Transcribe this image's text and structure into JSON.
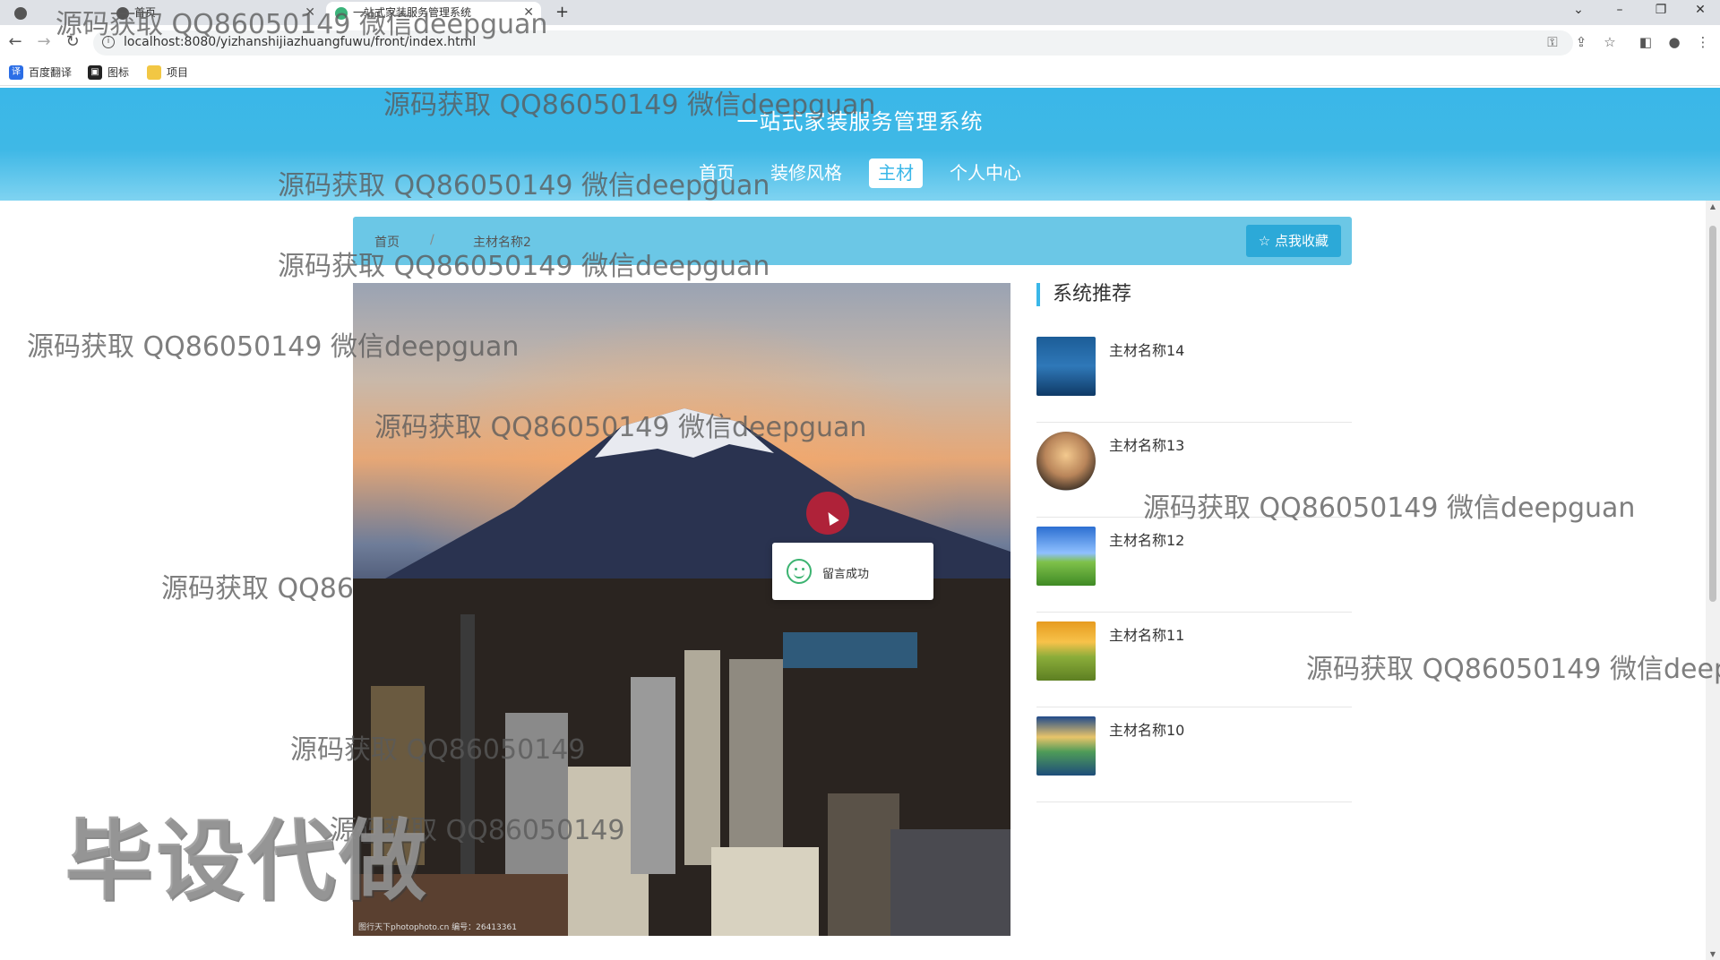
{
  "browser": {
    "tabs": [
      {
        "label": "首页",
        "active": false
      },
      {
        "label": "一站式家装服务管理系统",
        "active": true
      }
    ],
    "new_tab_icon": "+",
    "url": "localhost:8080/yizhanshijiazhuangfuwu/front/index.html",
    "bookmarks": [
      {
        "label": "百度翻译",
        "icon": "translate-icon"
      },
      {
        "label": "图标",
        "icon": "image-icon"
      },
      {
        "label": "项目",
        "icon": "folder-icon"
      }
    ]
  },
  "site": {
    "title": "一站式家装服务管理系统",
    "nav": [
      {
        "label": "首页",
        "active": false
      },
      {
        "label": "装修风格",
        "active": false
      },
      {
        "label": "主材",
        "active": true
      },
      {
        "label": "个人中心",
        "active": false
      }
    ],
    "accent_color": "#3ab7e8"
  },
  "breadcrumb": {
    "home": "首页",
    "separator": "/",
    "current": "主材名称2",
    "favorite_button": "☆ 点我收藏"
  },
  "detail": {
    "image_credit": "图行天下photophoto.cn 编号：26413361"
  },
  "toast": {
    "message": "留言成功"
  },
  "sidebar": {
    "title": "系统推荐",
    "items": [
      {
        "name": "主材名称14"
      },
      {
        "name": "主材名称13"
      },
      {
        "name": "主材名称12"
      },
      {
        "name": "主材名称11"
      },
      {
        "name": "主材名称10"
      }
    ]
  },
  "watermarks": {
    "text": "源码获取 QQ86050149 微信deepguan",
    "partial_1": "源码获取 QQ86",
    "partial_2": "源码获取 QQ86050149 微信deep",
    "partial_3": "源码获取 QQ86050149",
    "big": "毕设代做"
  }
}
